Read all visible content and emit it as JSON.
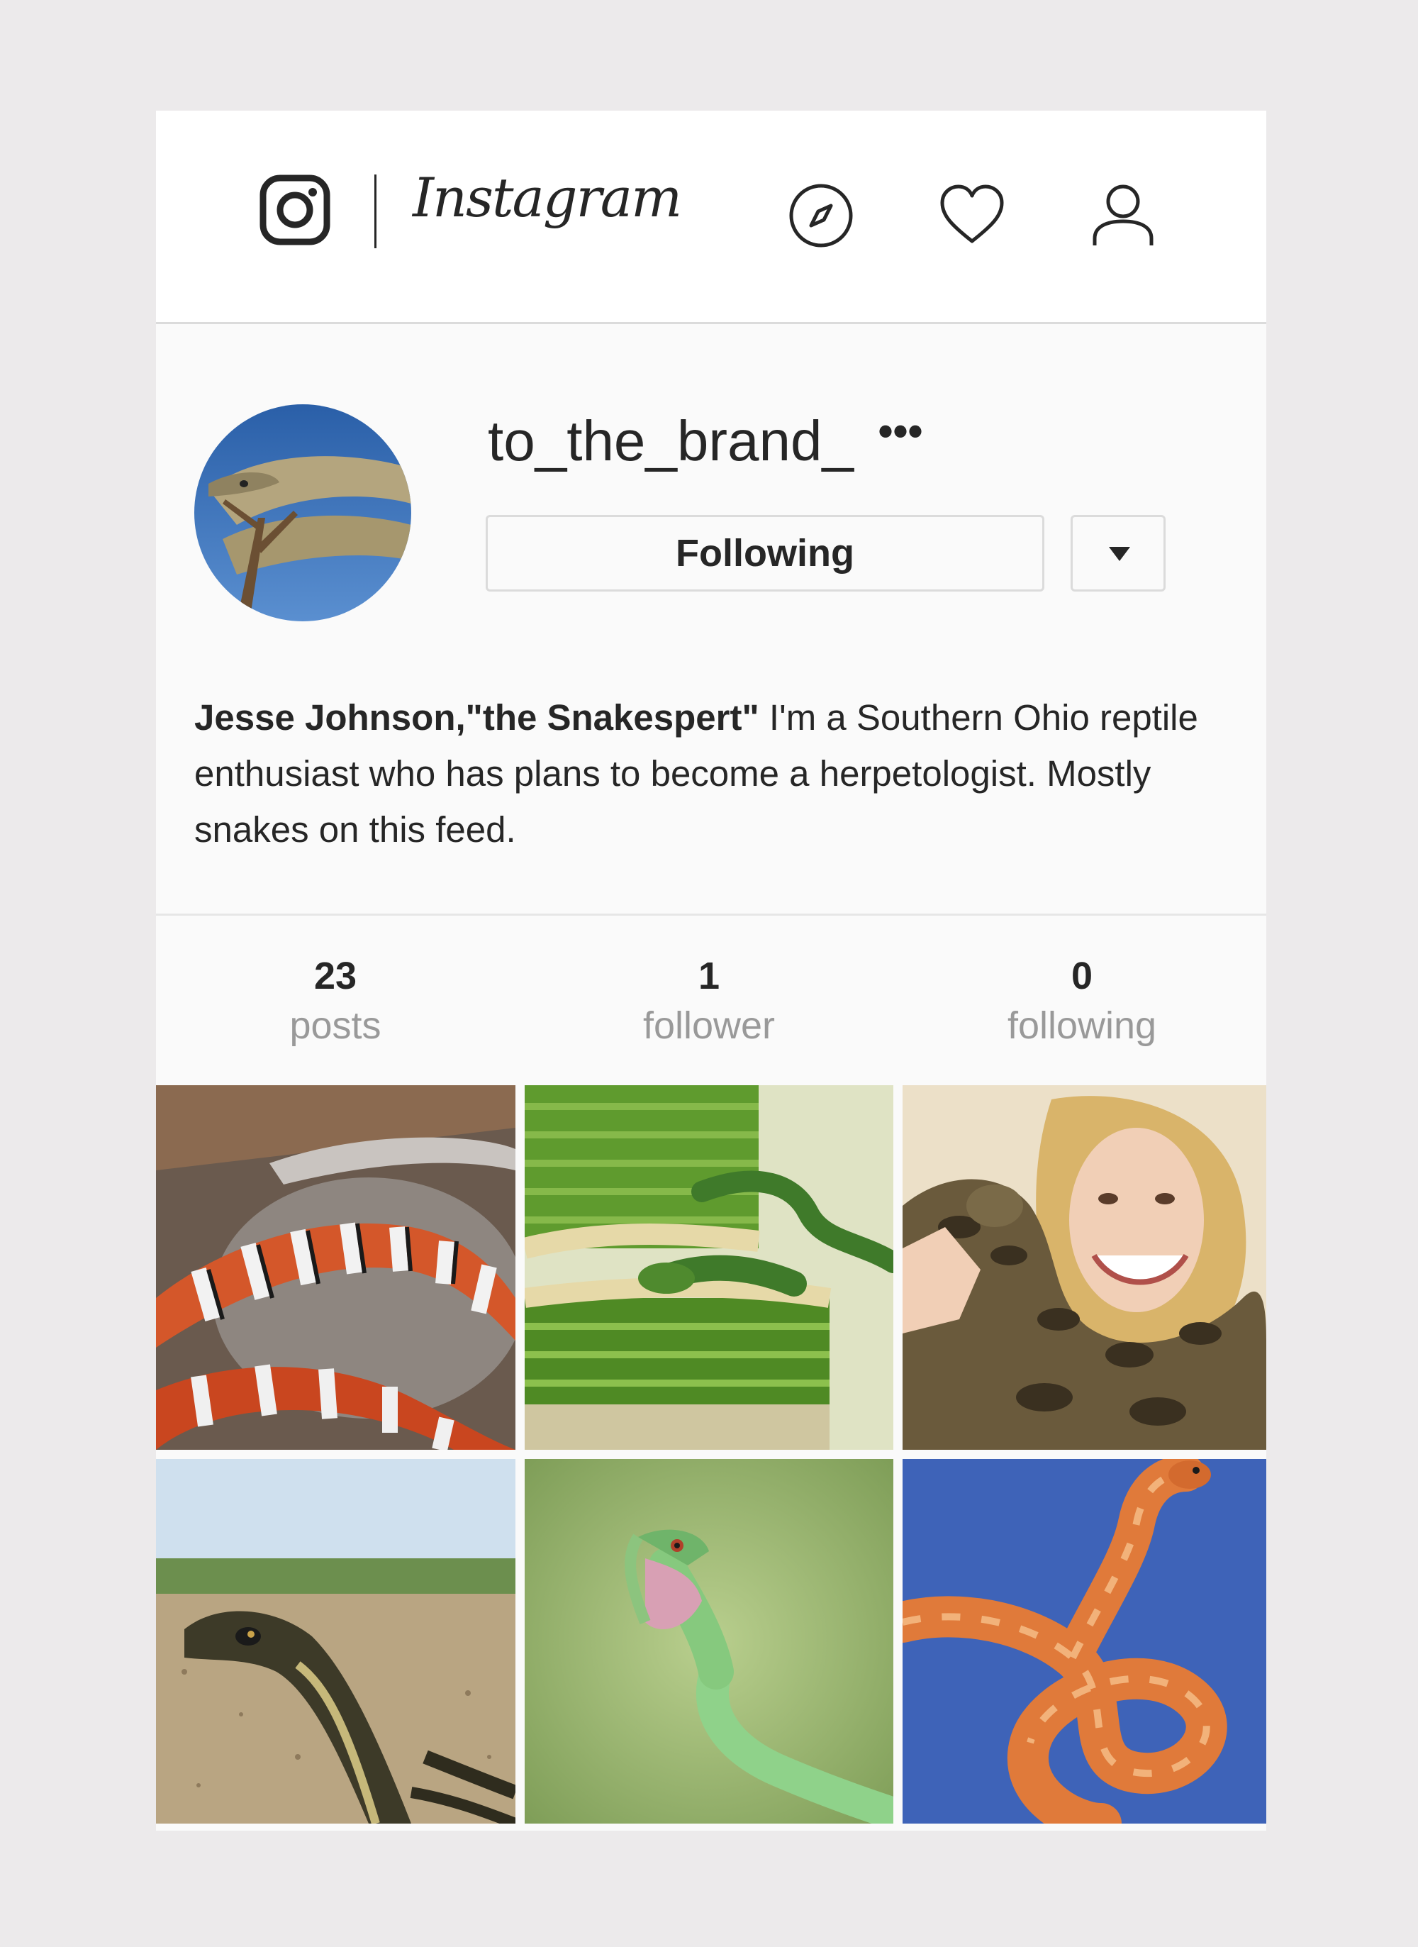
{
  "header": {
    "wordmark": "Instagram",
    "icons": [
      "instagram-glyph-icon",
      "compass-icon",
      "heart-icon",
      "profile-icon"
    ]
  },
  "profile": {
    "username": "to_the_brand_",
    "more_label": "•••",
    "follow_button": "Following",
    "bio_name": "Jesse Johnson,\"the Snakespert\"",
    "bio_text": " I'm a Southern Ohio reptile enthusiast who has plans to become a herpetologist. Mostly snakes on this feed."
  },
  "stats": {
    "posts": {
      "count": "23",
      "label": "posts"
    },
    "followers": {
      "count": "1",
      "label": "follower"
    },
    "following": {
      "count": "0",
      "label": "following"
    }
  },
  "grid": {
    "tiles": [
      {
        "alt": "red and white banded milk snake on rocks"
      },
      {
        "alt": "green snake in woven basket"
      },
      {
        "alt": "woman holding a large boa"
      },
      {
        "alt": "garter snake on sand"
      },
      {
        "alt": "green vine snake with open mouth"
      },
      {
        "alt": "orange corn snake on blue background"
      }
    ]
  },
  "colors": {
    "background": "#eceaeb",
    "panel": "#fafafa",
    "header": "#ffffff",
    "border": "#dbdbdb",
    "muted_text": "#999999",
    "text": "#262626"
  }
}
